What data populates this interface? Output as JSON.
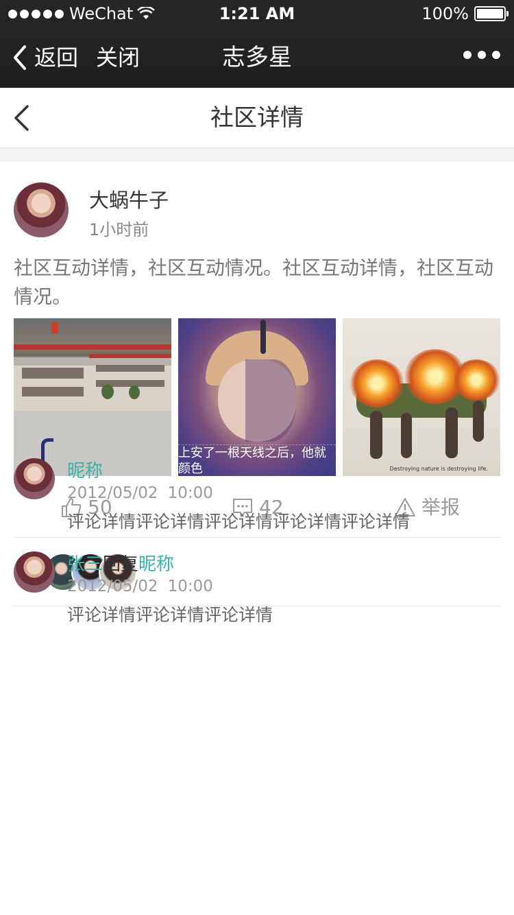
{
  "status_bar": {
    "carrier": "WeChat",
    "time": "1:21 AM",
    "battery": "100%",
    "battery_level": 1.0
  },
  "wechat_nav": {
    "back_label": "返回",
    "close_label": "关闭",
    "title": "志多星"
  },
  "page_header": {
    "title": "社区详情"
  },
  "post": {
    "author": "大蜗牛子",
    "time": "1小时前",
    "content": "社区互动详情，社区互动情况。社区互动详情，社区互动情况。",
    "images": [
      {
        "icon": "school-courtyard-photo"
      },
      {
        "icon": "antenna-man-portrait",
        "caption_line1": "上安了一根天线之后，他就",
        "caption_line2": "颜色"
      },
      {
        "icon": "burning-creature-poster",
        "tagline": "Destroying nature is destroying life."
      }
    ],
    "likes": "50",
    "comments_count": "42",
    "report_label": "举报"
  },
  "likers": {
    "icon": "thumbs-up-icon",
    "color": "#f5a623"
  },
  "comments": [
    {
      "name": "昵称",
      "date": "2012/05/02",
      "time": "10:00",
      "text": "评论详情评论详情评论详情评论详情评论详情"
    },
    {
      "name": "张三",
      "reply_word": "回复",
      "reply_to": "昵称",
      "date": "2012/05/02",
      "time": "10:00",
      "text": "评论详情评论详情评论详情"
    }
  ],
  "colors": {
    "accent": "#3bb3a9",
    "nav_bg": "#232323",
    "like_orange": "#f5a623"
  }
}
